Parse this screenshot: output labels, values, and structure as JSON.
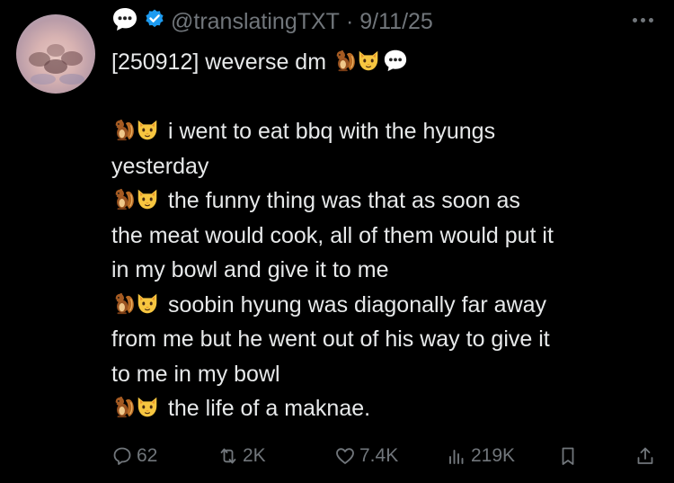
{
  "tweet": {
    "handle": "@translatingTXT",
    "separator": "·",
    "date": "9/11/25",
    "title_text": "[250912] weverse dm",
    "lines": [
      "i went to eat bbq with the hyungs",
      "yesterday",
      "the funny thing was that as soon as",
      "the meat would cook, all of them would put it",
      "in my bowl and give it to me",
      "soobin hyung was diagonally far away",
      "from me but he went out of his way to give it",
      "to me in my bowl",
      "the life of a maknae."
    ],
    "icons": {
      "header_badge": "speech-bubble-icon",
      "verified": "verified-badge-icon",
      "speaker_emoji_1": "chipmunk-emoji",
      "speaker_emoji_2": "cat-face-emoji",
      "trailing_emoji": "speech-bubble-icon"
    }
  },
  "actions": {
    "replies": "62",
    "reposts": "2K",
    "likes": "7.4K",
    "views": "219K"
  },
  "colors": {
    "background": "#000000",
    "text": "#e7e9ea",
    "secondary": "#71767b",
    "verified": "#1d9bf0"
  }
}
